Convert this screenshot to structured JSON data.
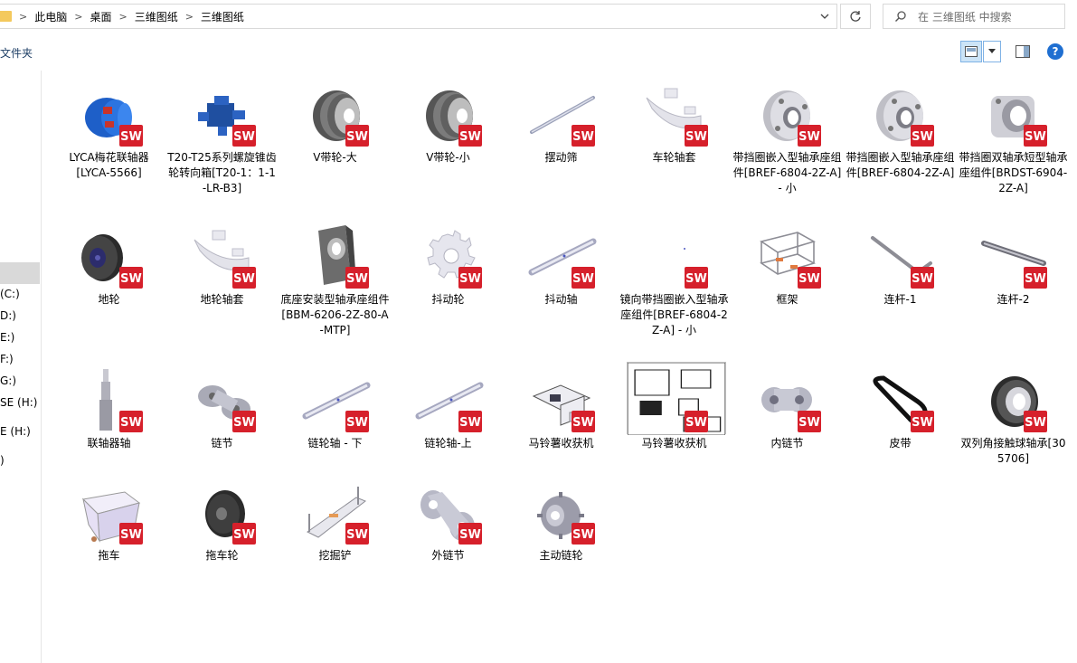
{
  "breadcrumb": [
    "此电脑",
    "桌面",
    "三维图纸",
    "三维图纸"
  ],
  "search": {
    "placeholder": "在 三维图纸 中搜索"
  },
  "toolbar": {
    "left_label": "文件夹"
  },
  "nav": [
    {
      "label": "(C:)"
    },
    {
      "label": "D:)"
    },
    {
      "label": "E:)"
    },
    {
      "label": "F:)"
    },
    {
      "label": "G:)"
    },
    {
      "label": "SE (H:)"
    },
    {
      "label": "E (H:)"
    },
    {
      "label": ")"
    }
  ],
  "files": [
    {
      "name": "LYCA梅花联轴器\n[LYCA-5566]",
      "icon": "coupling"
    },
    {
      "name": "T20-T25系列螺旋锥齿轮转向箱[T20-1：1-1-LR-B3]",
      "icon": "gearbox"
    },
    {
      "name": "V带轮-大",
      "icon": "pulley"
    },
    {
      "name": "V带轮-小",
      "icon": "pulley"
    },
    {
      "name": "摆动筛",
      "icon": "rod"
    },
    {
      "name": "车轮轴套",
      "icon": "sleeve"
    },
    {
      "name": "带挡圈嵌入型轴承座组件[BREF-6804-2Z-A] - 小",
      "icon": "flange"
    },
    {
      "name": "带挡圈嵌入型轴承座组件[BREF-6804-2Z-A]",
      "icon": "flange"
    },
    {
      "name": "带挡圈双轴承短型轴承座组件[BRDST-6904-2Z-A]",
      "icon": "flange2"
    },
    {
      "name": "地轮",
      "icon": "wheel"
    },
    {
      "name": "地轮轴套",
      "icon": "sleeve"
    },
    {
      "name": "底座安装型轴承座组件[BBM-6206-2Z-80-A-MTP]",
      "icon": "block"
    },
    {
      "name": "抖动轮",
      "icon": "gear"
    },
    {
      "name": "抖动轴",
      "icon": "shaft"
    },
    {
      "name": "镜向带挡圈嵌入型轴承座组件[BREF-6804-2Z-A] - 小",
      "icon": "empty"
    },
    {
      "name": "框架",
      "icon": "frame"
    },
    {
      "name": "连杆-1",
      "icon": "link1"
    },
    {
      "name": "连杆-2",
      "icon": "link2"
    },
    {
      "name": "联轴器轴",
      "icon": "vshaft"
    },
    {
      "name": "链节",
      "icon": "chain"
    },
    {
      "name": "链轮轴 - 下",
      "icon": "shaft"
    },
    {
      "name": "链轮轴-上",
      "icon": "shaft"
    },
    {
      "name": "马铃薯收获机",
      "icon": "machine"
    },
    {
      "name": "马铃薯收获机",
      "icon": "drawing"
    },
    {
      "name": "内链节",
      "icon": "chain2"
    },
    {
      "name": "皮带",
      "icon": "belt"
    },
    {
      "name": "双列角接触球轴承[305706]",
      "icon": "bearing"
    },
    {
      "name": "拖车",
      "icon": "trailer"
    },
    {
      "name": "拖车轮",
      "icon": "smallwheel"
    },
    {
      "name": "挖掘铲",
      "icon": "shovel"
    },
    {
      "name": "外链节",
      "icon": "chain3"
    },
    {
      "name": "主动链轮",
      "icon": "sprocket"
    }
  ],
  "colors": {
    "accent": "#1f6fd1",
    "selection": "#cce4f7",
    "sw_red": "#d6202b"
  }
}
